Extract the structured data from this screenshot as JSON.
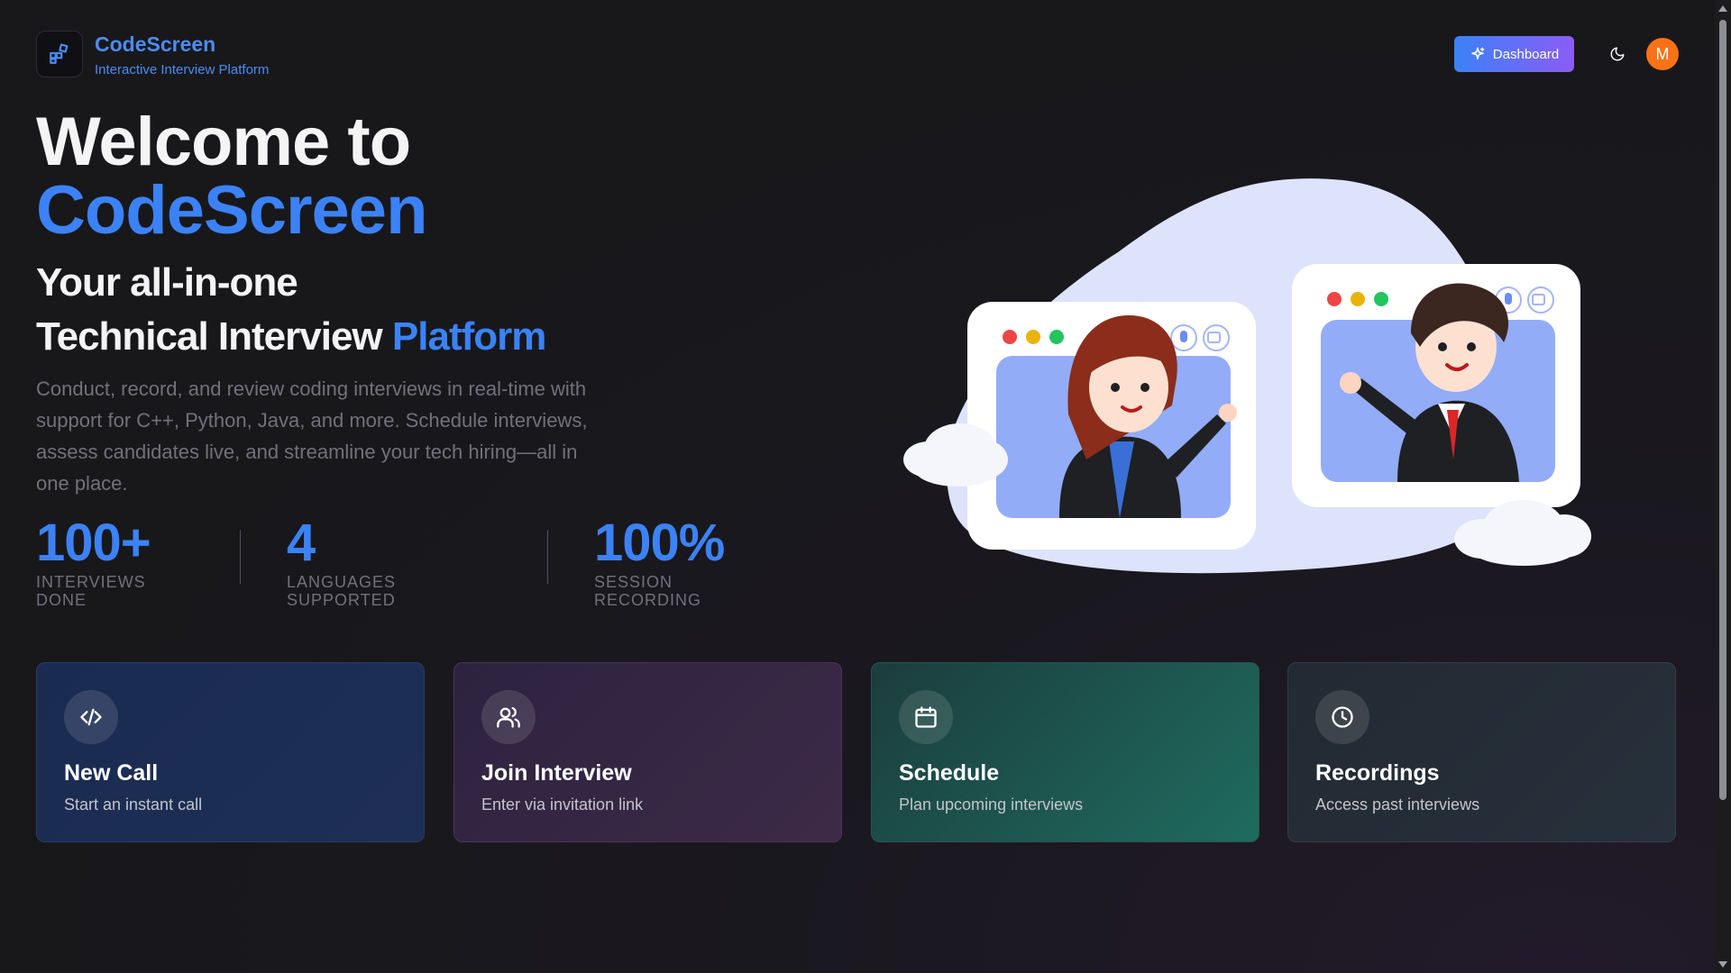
{
  "header": {
    "brand_name": "CodeScreen",
    "brand_subtitle": "Interactive Interview Platform",
    "dashboard_label": "Dashboard",
    "avatar_initial": "M"
  },
  "hero": {
    "title_line1": "Welcome to",
    "title_line2": "CodeScreen",
    "subtitle_line1": "Your all-in-one",
    "subtitle_line2_prefix": "Technical Interview",
    "subtitle_line2_highlight": "Platform",
    "description": "Conduct, record, and review coding interviews in real-time with support for C++, Python, Java, and more. Schedule interviews, assess candidates live, and streamline your tech hiring—all in one place."
  },
  "stats": [
    {
      "value": "100+",
      "label": "INTERVIEWS DONE"
    },
    {
      "value": "4",
      "label": "LANGUAGES SUPPORTED"
    },
    {
      "value": "100%",
      "label": "SESSION RECORDING"
    }
  ],
  "cards": [
    {
      "title": "New Call",
      "desc": "Start an instant call",
      "icon": "code-icon"
    },
    {
      "title": "Join Interview",
      "desc": "Enter via invitation link",
      "icon": "users-icon"
    },
    {
      "title": "Schedule",
      "desc": "Plan upcoming interviews",
      "icon": "calendar-icon"
    },
    {
      "title": "Recordings",
      "desc": "Access past interviews",
      "icon": "clock-icon"
    }
  ],
  "colors": {
    "accent": "#3b82f6",
    "background": "#18181b",
    "avatar": "#f97316"
  }
}
